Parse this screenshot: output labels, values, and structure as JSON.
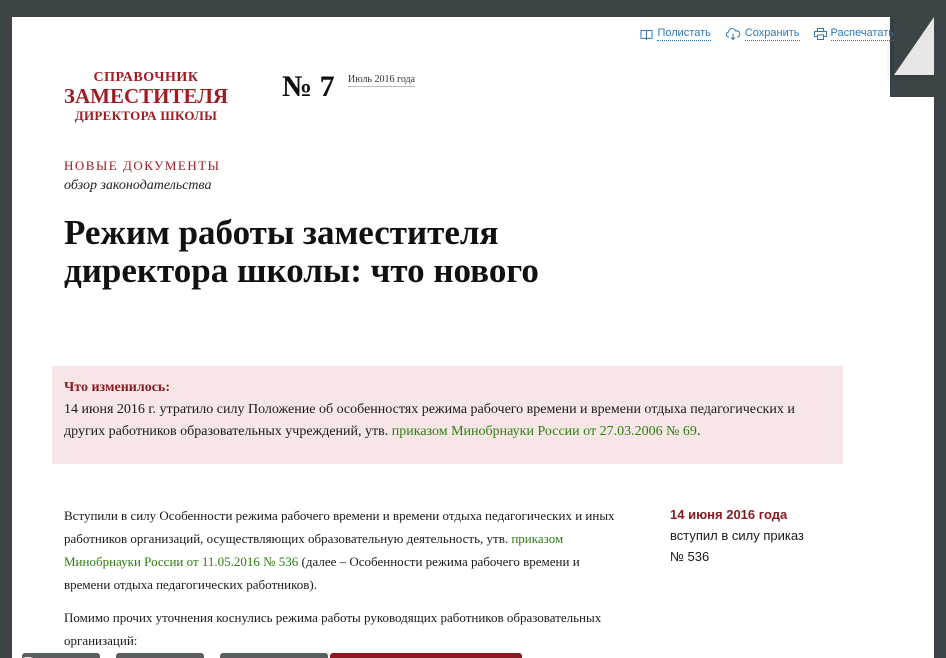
{
  "toolbar": {
    "flip": "Полистать",
    "save": "Сохранить",
    "print": "Распечатать",
    "link_color": "#2f79b9"
  },
  "brand": {
    "line1": "СПРАВОЧНИК",
    "line2": "ЗАМЕСТИТЕЛЯ",
    "line3": "ДИРЕКТОРА ШКОЛЫ",
    "color": "#a01c24"
  },
  "issue": {
    "number": "№ 7",
    "date": "Июль 2016 года"
  },
  "article": {
    "rubric": "НОВЫЕ ДОКУМЕНТЫ",
    "subrubric": "обзор законодательства",
    "title": "Режим работы заместителя директора школы: что нового"
  },
  "changed": {
    "heading": "Что изменилось:",
    "text_before": "14 июня 2016 г. утратило силу Положение об особенностях режима рабочего времени и времени отдыха педагогических и других работников образовательных учреждений, утв. ",
    "link": "приказом Минобрнауки России от 27.03.2006 № 69",
    "text_after": ".",
    "background": "#f6e6e6"
  },
  "body": {
    "p1_before": "Вступили в силу Особенности режима рабочего времени и времени отдыха педагогических и иных работников организаций, осуществляющих образовательную деятельность, утв. ",
    "p1_link": "приказом Минобрнауки России от 11.05.2016 № 536",
    "p1_after": " (далее – Особенности режима рабочего времени и времени отдыха педагогических работников).",
    "p2": "Помимо прочих уточнения коснулись режима работы руководящих работников образовательных организаций:",
    "link_color": "#2f7d12"
  },
  "sidebar": {
    "date": "14 июня 2016 года",
    "text": "вступил в силу приказ № 536"
  }
}
